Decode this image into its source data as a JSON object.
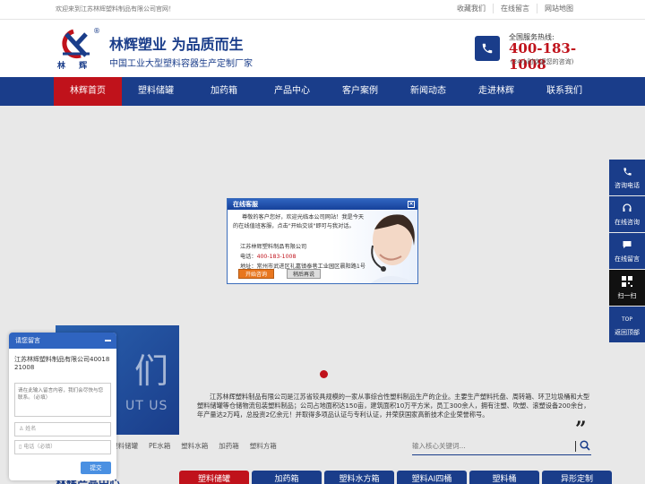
{
  "topbar": {
    "welcome": "欢迎来到江苏林辉塑料制品有限公司官网！",
    "links": [
      "收藏我们",
      "在线留言",
      "网站地图"
    ]
  },
  "header": {
    "logo_text": "林 辉",
    "logo_reg": "®",
    "slogan": "林辉塑业 为品质而生",
    "subtitle": "中国工业大型塑料容器生产定制厂家",
    "hotline_label": "全国服务热线:",
    "hotline_number": "400-183-1008",
    "hotline_note": "(24小时欢迎您的咨询)"
  },
  "nav": {
    "items": [
      "林辉首页",
      "塑料储罐",
      "加药箱",
      "产品中心",
      "客户案例",
      "新闻动态",
      "走进林辉",
      "联系我们"
    ],
    "active_index": 0
  },
  "about": {
    "big_text": "们",
    "en_text": "UT US",
    "paragraph": "江苏林辉塑料制品有限公司是江苏省较具规模的一家从事综合性塑料制品生产的企业。主要生产塑料托盘、周转箱、环卫垃圾桶和大型塑料储罐等仓储物流包装塑料制品；公司占地面积达150亩，建筑面积10万平方米，员工300余人，拥有注塑、吹塑、滚塑设备200余台，年产量达2万吨，总投资2亿余元！并取得多项品认证与专利认证，并荣获国家高新技术企业荣誉称号。",
    "quote": "”"
  },
  "products": {
    "filters": [
      "塑料储罐",
      "PE水箱",
      "塑料水箱",
      "加药箱",
      "塑料方箱"
    ],
    "search_placeholder": "输入核心关键词...",
    "section_title": "林辉产品中心",
    "tabs": [
      "塑料储罐",
      "加药箱",
      "塑料水方箱",
      "塑料AI四桶",
      "塑料桶",
      "异形定制"
    ]
  },
  "side": {
    "buttons": [
      "咨询电话",
      "在线咨询",
      "在线留言",
      "扫一扫",
      "返回顶部"
    ],
    "top_icon_text": "TOP"
  },
  "chat": {
    "title": "在线客服",
    "close": "×",
    "greeting": "尊敬的客户您好，欢迎光临本公司网站！我是今天的在线值班客服，点击\"开始交谈\"即可与我对话。",
    "company": "江苏林辉塑料制品有限公司",
    "tel_label": "电话：",
    "tel": "400-183-1008",
    "address": "地址：常州市武进区礼嘉镇泰巷工业园区晨阳路1号",
    "start_button": "开始咨询",
    "later_button": "稍后再说"
  },
  "message": {
    "title": "请您留言",
    "company": "江苏林辉塑料制品有限公司4001821008",
    "content_placeholder": "请在此输入留言内容，我们会尽快与您联系。（必填）",
    "name_placeholder": "姓名",
    "phone_placeholder": "电话（必填）",
    "submit": "提交"
  },
  "colors": {
    "brand_blue": "#1a3d8a",
    "brand_red": "#c0121b",
    "hotline_red": "#c0121b"
  }
}
